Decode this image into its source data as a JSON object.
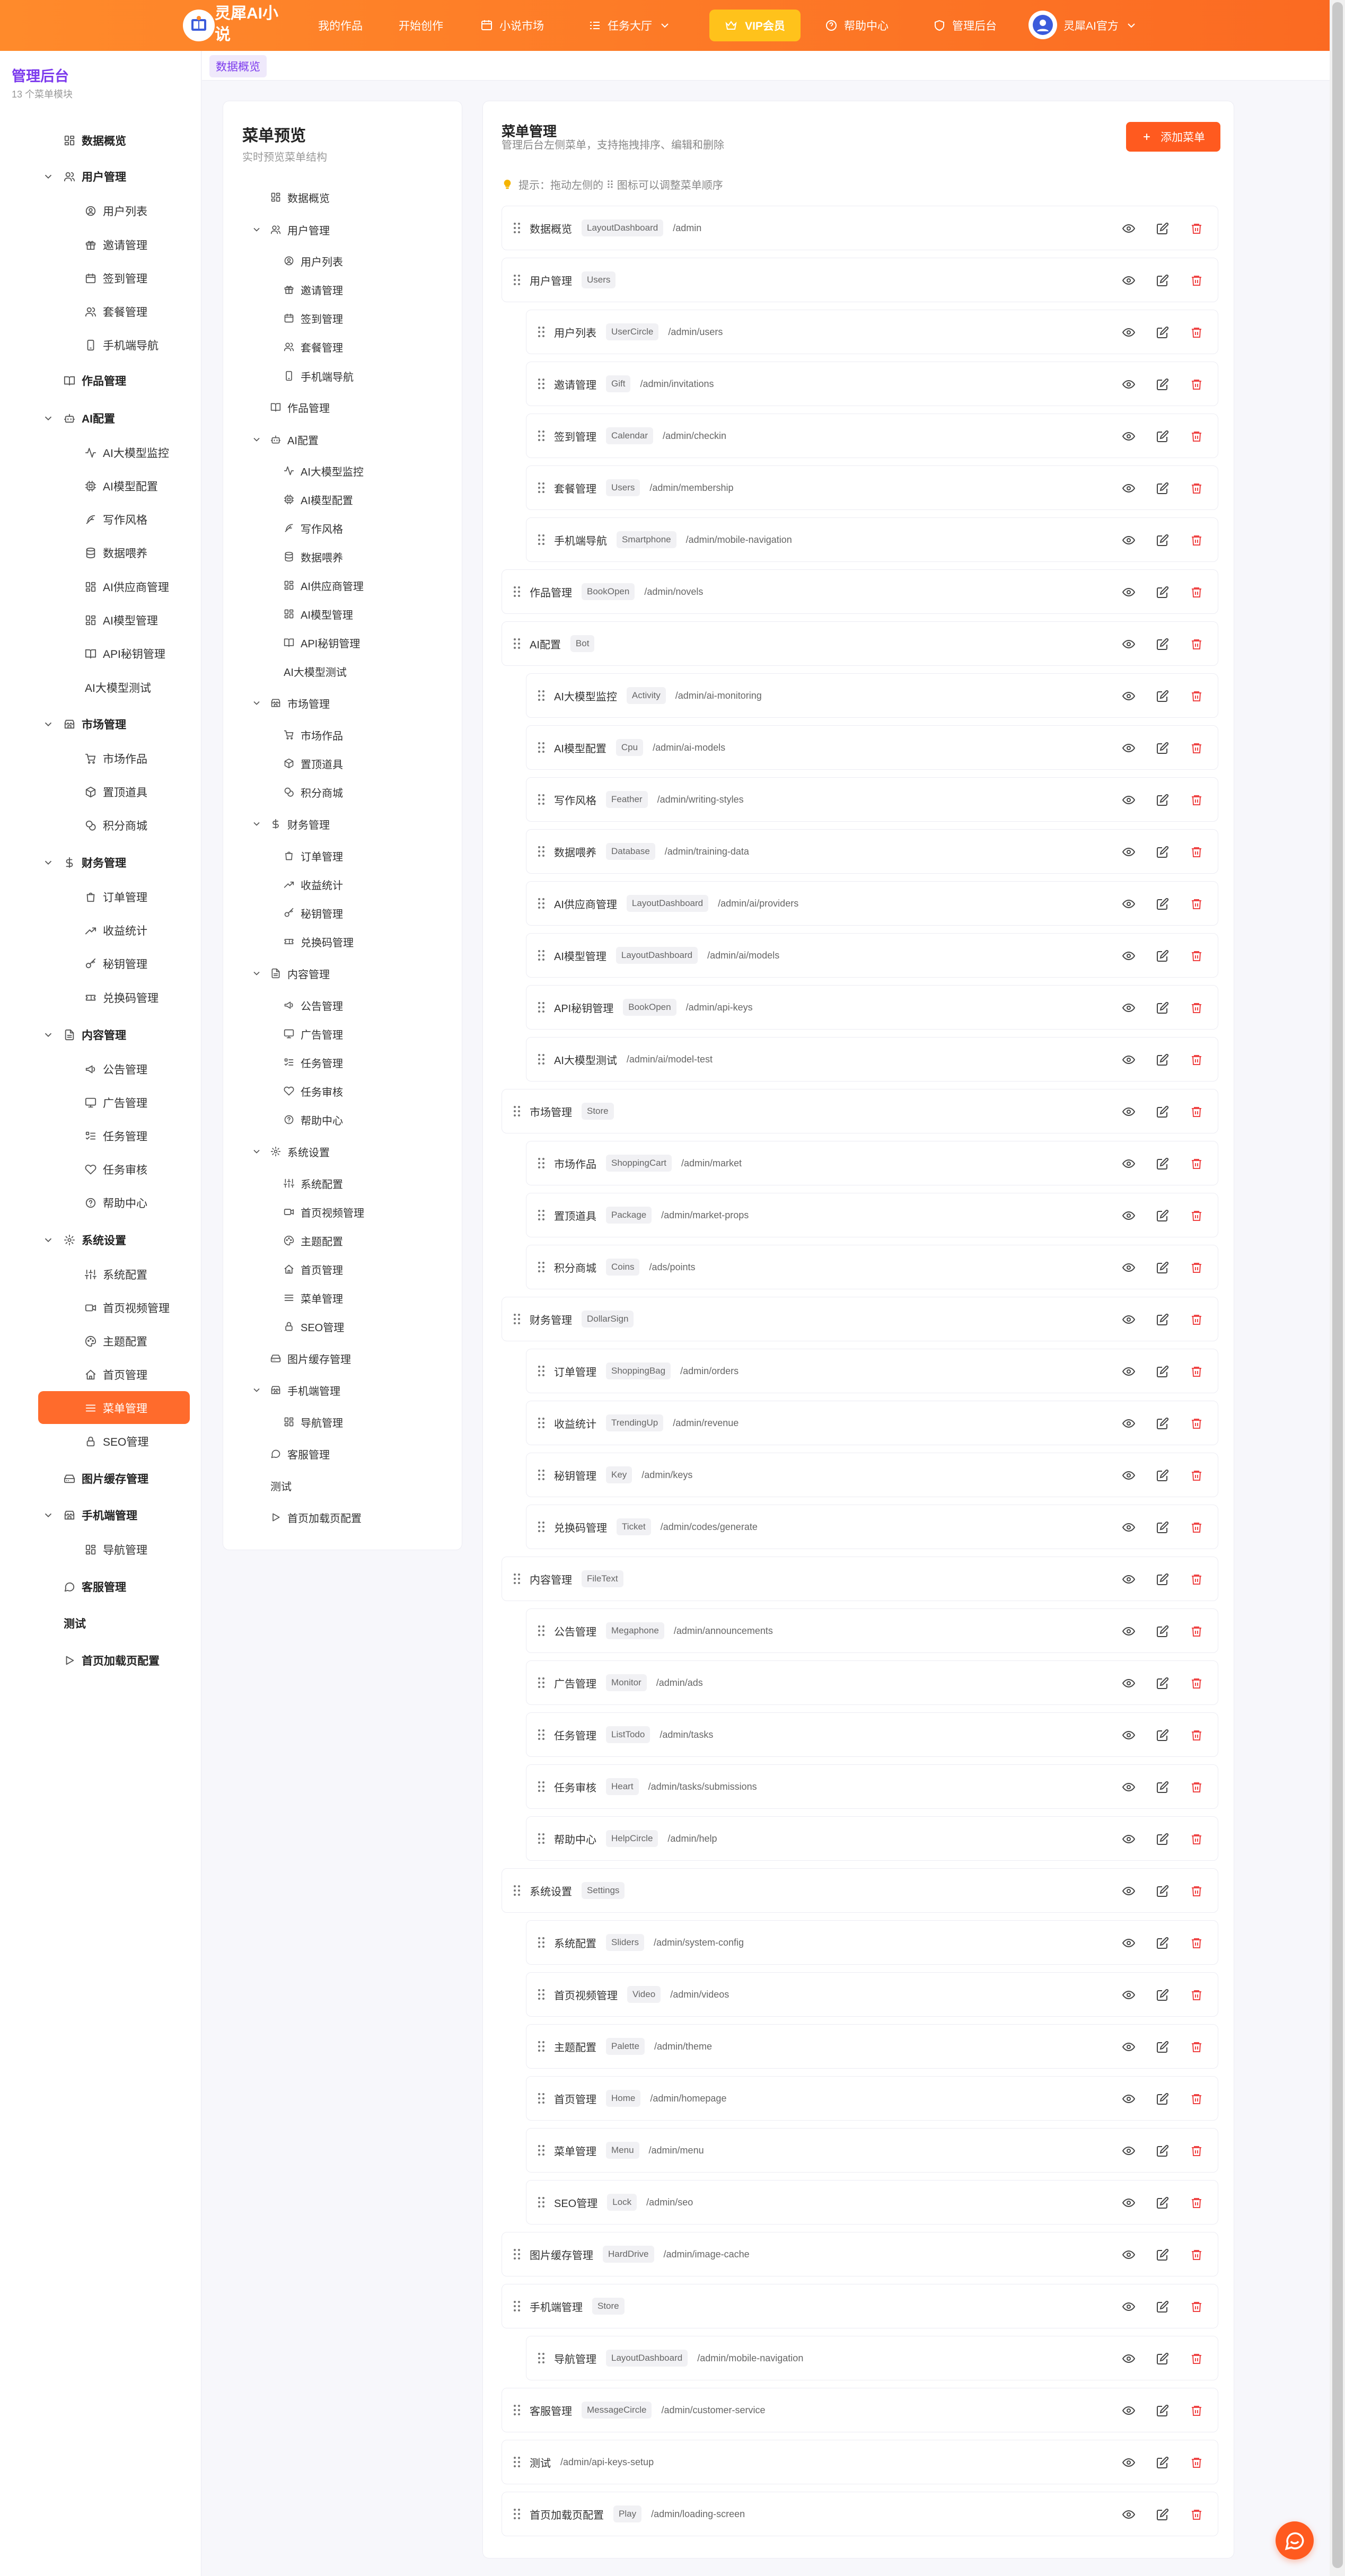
{
  "header": {
    "brand": "灵犀AI小说",
    "nav": [
      {
        "label": "我的作品"
      },
      {
        "label": "开始创作"
      },
      {
        "label": "小说市场"
      },
      {
        "label": "任务大厅"
      },
      {
        "label": "VIP会员"
      },
      {
        "label": "帮助中心"
      },
      {
        "label": "管理后台"
      }
    ],
    "user_name": "灵犀AI官方"
  },
  "sidebar": {
    "title": "管理后台",
    "subtitle": "13 个菜单模块",
    "items": [
      {
        "label": "数据概览",
        "icon": "layout-dashboard-icon"
      },
      {
        "label": "用户管理",
        "icon": "users-icon"
      },
      {
        "label": "用户列表",
        "icon": "user-circle-icon"
      },
      {
        "label": "邀请管理",
        "icon": "gift-icon"
      },
      {
        "label": "签到管理",
        "icon": "calendar-icon"
      },
      {
        "label": "套餐管理",
        "icon": "users-icon"
      },
      {
        "label": "手机端导航",
        "icon": "smartphone-icon"
      },
      {
        "label": "作品管理",
        "icon": "book-open-icon"
      },
      {
        "label": "AI配置",
        "icon": "bot-icon"
      },
      {
        "label": "AI大模型监控",
        "icon": "activity-icon"
      },
      {
        "label": "AI模型配置",
        "icon": "cpu-icon"
      },
      {
        "label": "写作风格",
        "icon": "feather-icon"
      },
      {
        "label": "数据喂养",
        "icon": "database-icon"
      },
      {
        "label": "AI供应商管理",
        "icon": "layout-dashboard-icon"
      },
      {
        "label": "AI模型管理",
        "icon": "layout-dashboard-icon"
      },
      {
        "label": "API秘钥管理",
        "icon": "book-open-icon"
      },
      {
        "label": "AI大模型测试",
        "icon": ""
      },
      {
        "label": "市场管理",
        "icon": "store-icon"
      },
      {
        "label": "市场作品",
        "icon": "shopping-cart-icon"
      },
      {
        "label": "置顶道具",
        "icon": "package-icon"
      },
      {
        "label": "积分商城",
        "icon": "coins-icon"
      },
      {
        "label": "财务管理",
        "icon": "dollar-sign-icon"
      },
      {
        "label": "订单管理",
        "icon": "shopping-bag-icon"
      },
      {
        "label": "收益统计",
        "icon": "trending-up-icon"
      },
      {
        "label": "秘钥管理",
        "icon": "key-icon"
      },
      {
        "label": "兑换码管理",
        "icon": "ticket-icon"
      },
      {
        "label": "内容管理",
        "icon": "file-text-icon"
      },
      {
        "label": "公告管理",
        "icon": "megaphone-icon"
      },
      {
        "label": "广告管理",
        "icon": "monitor-icon"
      },
      {
        "label": "任务管理",
        "icon": "list-todo-icon"
      },
      {
        "label": "任务审核",
        "icon": "heart-icon"
      },
      {
        "label": "帮助中心",
        "icon": "help-circle-icon"
      },
      {
        "label": "系统设置",
        "icon": "settings-icon"
      },
      {
        "label": "系统配置",
        "icon": "sliders-icon"
      },
      {
        "label": "首页视频管理",
        "icon": "video-icon"
      },
      {
        "label": "主题配置",
        "icon": "palette-icon"
      },
      {
        "label": "首页管理",
        "icon": "home-icon"
      },
      {
        "label": "菜单管理",
        "icon": "menu-icon"
      },
      {
        "label": "SEO管理",
        "icon": "lock-icon"
      },
      {
        "label": "图片缓存管理",
        "icon": "hard-drive-icon"
      },
      {
        "label": "手机端管理",
        "icon": "store-icon"
      },
      {
        "label": "导航管理",
        "icon": "layout-dashboard-icon"
      },
      {
        "label": "客服管理",
        "icon": "message-circle-icon"
      },
      {
        "label": "测试",
        "icon": ""
      },
      {
        "label": "首页加载页配置",
        "icon": "play-icon"
      }
    ]
  },
  "breadcrumb": {
    "tab": "数据概览"
  },
  "preview": {
    "title": "菜单预览",
    "subtitle": "实时预览菜单结构"
  },
  "menu_manager": {
    "title": "菜单管理",
    "subtitle": "管理后台左侧菜单，支持拖拽排序、编辑和删除",
    "add_label": "添加菜单",
    "tip": "提示：拖动左侧的 ⠿ 图标可以调整菜单顺序",
    "rows": [
      {
        "label": "数据概览",
        "icon": "LayoutDashboard",
        "path": "/admin"
      },
      {
        "label": "用户管理",
        "icon": "Users",
        "path": ""
      },
      {
        "label": "用户列表",
        "icon": "UserCircle",
        "path": "/admin/users"
      },
      {
        "label": "邀请管理",
        "icon": "Gift",
        "path": "/admin/invitations"
      },
      {
        "label": "签到管理",
        "icon": "Calendar",
        "path": "/admin/checkin"
      },
      {
        "label": "套餐管理",
        "icon": "Users",
        "path": "/admin/membership"
      },
      {
        "label": "手机端导航",
        "icon": "Smartphone",
        "path": "/admin/mobile-navigation"
      },
      {
        "label": "作品管理",
        "icon": "BookOpen",
        "path": "/admin/novels"
      },
      {
        "label": "AI配置",
        "icon": "Bot",
        "path": ""
      },
      {
        "label": "AI大模型监控",
        "icon": "Activity",
        "path": "/admin/ai-monitoring"
      },
      {
        "label": "AI模型配置",
        "icon": "Cpu",
        "path": "/admin/ai-models"
      },
      {
        "label": "写作风格",
        "icon": "Feather",
        "path": "/admin/writing-styles"
      },
      {
        "label": "数据喂养",
        "icon": "Database",
        "path": "/admin/training-data"
      },
      {
        "label": "AI供应商管理",
        "icon": "LayoutDashboard",
        "path": "/admin/ai/providers"
      },
      {
        "label": "AI模型管理",
        "icon": "LayoutDashboard",
        "path": "/admin/ai/models"
      },
      {
        "label": "API秘钥管理",
        "icon": "BookOpen",
        "path": "/admin/api-keys"
      },
      {
        "label": "AI大模型测试",
        "icon": "",
        "path": "/admin/ai/model-test"
      },
      {
        "label": "市场管理",
        "icon": "Store",
        "path": ""
      },
      {
        "label": "市场作品",
        "icon": "ShoppingCart",
        "path": "/admin/market"
      },
      {
        "label": "置顶道具",
        "icon": "Package",
        "path": "/admin/market-props"
      },
      {
        "label": "积分商城",
        "icon": "Coins",
        "path": "/ads/points"
      },
      {
        "label": "财务管理",
        "icon": "DollarSign",
        "path": ""
      },
      {
        "label": "订单管理",
        "icon": "ShoppingBag",
        "path": "/admin/orders"
      },
      {
        "label": "收益统计",
        "icon": "TrendingUp",
        "path": "/admin/revenue"
      },
      {
        "label": "秘钥管理",
        "icon": "Key",
        "path": "/admin/keys"
      },
      {
        "label": "兑换码管理",
        "icon": "Ticket",
        "path": "/admin/codes/generate"
      },
      {
        "label": "内容管理",
        "icon": "FileText",
        "path": ""
      },
      {
        "label": "公告管理",
        "icon": "Megaphone",
        "path": "/admin/announcements"
      },
      {
        "label": "广告管理",
        "icon": "Monitor",
        "path": "/admin/ads"
      },
      {
        "label": "任务管理",
        "icon": "ListTodo",
        "path": "/admin/tasks"
      },
      {
        "label": "任务审核",
        "icon": "Heart",
        "path": "/admin/tasks/submissions"
      },
      {
        "label": "帮助中心",
        "icon": "HelpCircle",
        "path": "/admin/help"
      },
      {
        "label": "系统设置",
        "icon": "Settings",
        "path": ""
      },
      {
        "label": "系统配置",
        "icon": "Sliders",
        "path": "/admin/system-config"
      },
      {
        "label": "首页视频管理",
        "icon": "Video",
        "path": "/admin/videos"
      },
      {
        "label": "主题配置",
        "icon": "Palette",
        "path": "/admin/theme"
      },
      {
        "label": "首页管理",
        "icon": "Home",
        "path": "/admin/homepage"
      },
      {
        "label": "菜单管理",
        "icon": "Menu",
        "path": "/admin/menu"
      },
      {
        "label": "SEO管理",
        "icon": "Lock",
        "path": "/admin/seo"
      },
      {
        "label": "图片缓存管理",
        "icon": "HardDrive",
        "path": "/admin/image-cache"
      },
      {
        "label": "手机端管理",
        "icon": "Store",
        "path": ""
      },
      {
        "label": "导航管理",
        "icon": "LayoutDashboard",
        "path": "/admin/mobile-navigation"
      },
      {
        "label": "客服管理",
        "icon": "MessageCircle",
        "path": "/admin/customer-service"
      },
      {
        "label": "测试",
        "icon": "",
        "path": "/admin/api-keys-setup"
      },
      {
        "label": "首页加载页配置",
        "icon": "Play",
        "path": "/admin/loading-screen"
      }
    ]
  },
  "colors": {
    "header_gradient_start": "#ff8a2b",
    "header_gradient_end": "#fb6a22",
    "accent_orange": "#ff5a1f",
    "sidebar_active": "#ff6b2c",
    "sidebar_title": "#7c3aed",
    "vip_yellow": "#ffc21b",
    "delete_red": "#ef4444"
  }
}
